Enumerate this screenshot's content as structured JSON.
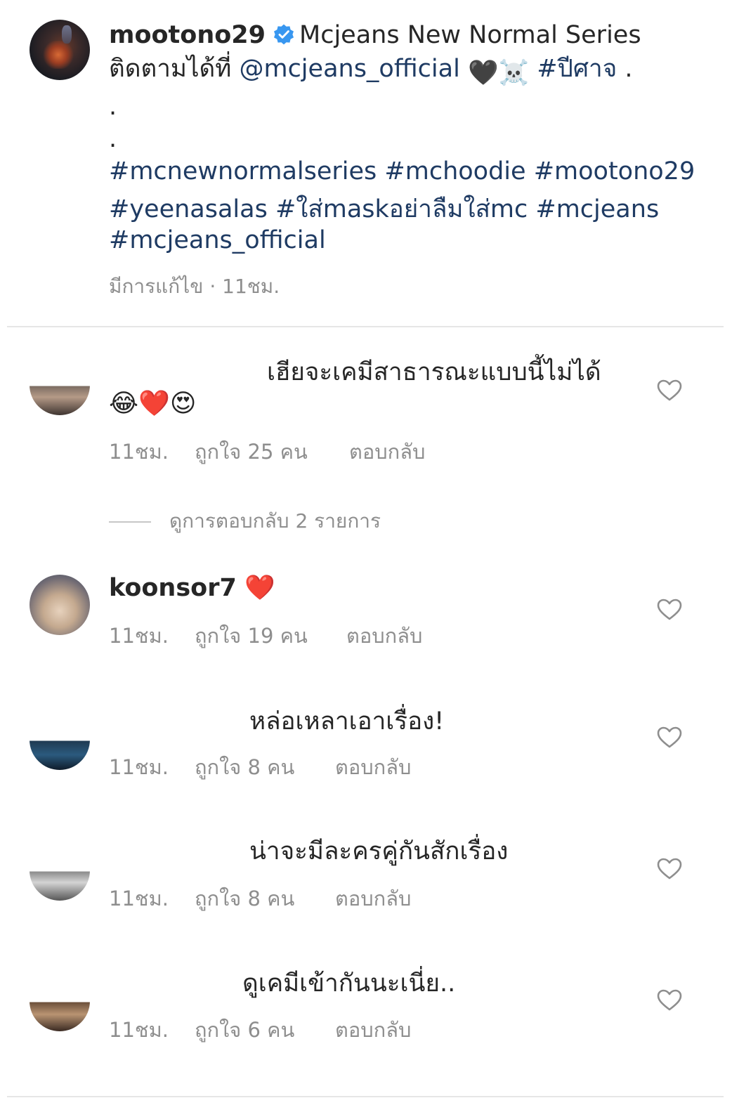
{
  "post": {
    "username": "mootono29",
    "caption_title": "Mcjeans New Normal Series",
    "caption_follow_prefix": "ติดตามได้ที่",
    "caption_mention": "@mcjeans_official",
    "caption_emojis": "🖤☠️",
    "caption_hashtag": "#ปีศาจ",
    "caption_trailing": ".",
    "dot_line_1": ".",
    "dot_line_2": ".",
    "hashtag_line_1": "#mcnewnormalseries #mchoodie #mootono29",
    "hashtag_line_2": "#yeenasalas #ใส่maskอย่าลืมใส่mc #mcjeans",
    "hashtag_line_3": "#mcjeans_official",
    "edited_label": "มีการแก้ไข",
    "time": "11ชม."
  },
  "comments": [
    {
      "text": "เฮียจะเคมีสาธารณะแบบนี้ไม่ได้",
      "text_line_2": "😂❤️😍",
      "time": "11ชม.",
      "likes": "ถูกใจ 25 คน",
      "reply": "ตอบกลับ"
    },
    {
      "username": "koonsor7",
      "text": "❤️",
      "time": "11ชม.",
      "likes": "ถูกใจ 19 คน",
      "reply": "ตอบกลับ"
    },
    {
      "text": "หล่อเหลาเอาเรื่อง!",
      "time": "11ชม.",
      "likes": "ถูกใจ 8 คน",
      "reply": "ตอบกลับ"
    },
    {
      "text": "น่าจะมีละครคู่กันสักเรื่อง",
      "time": "11ชม.",
      "likes": "ถูกใจ 8 คน",
      "reply": "ตอบกลับ"
    },
    {
      "text": "ดูเคมีเข้ากันนะเนี่ย..",
      "time": "11ชม.",
      "likes": "ถูกใจ 6 คน",
      "reply": "ตอบกลับ"
    }
  ],
  "view_replies_label": "ดูการตอบกลับ 2 รายการ",
  "colors": {
    "link": "#1f3b63",
    "meta": "#8e8e8e",
    "verified": "#3897f0"
  },
  "icons": [
    "verified-badge-icon",
    "heart-outline-icon"
  ]
}
